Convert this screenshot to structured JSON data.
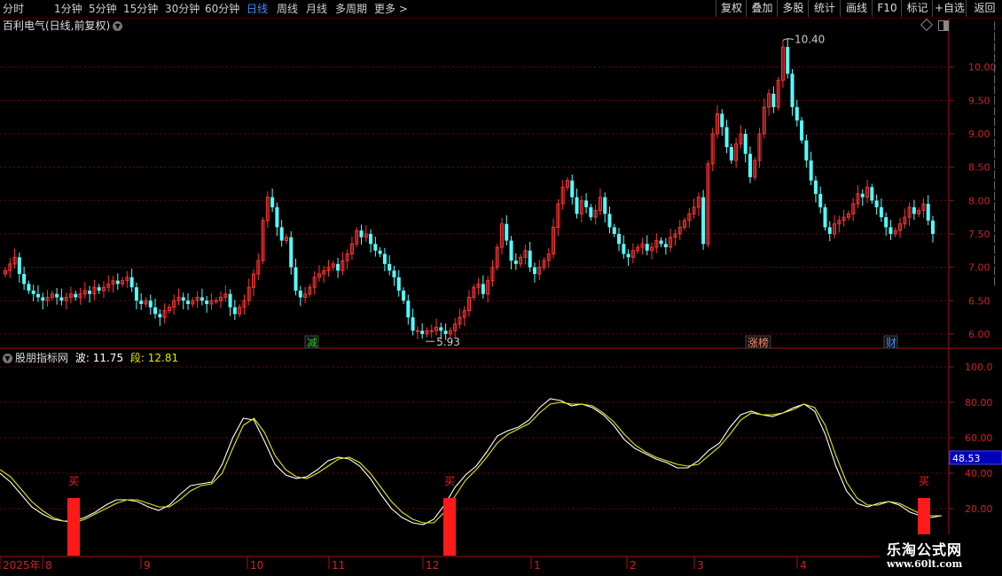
{
  "topbar": {
    "periods": [
      "分时",
      "1分钟",
      "5分钟",
      "15分钟",
      "30分钟",
      "60分钟",
      "日线",
      "周线",
      "月线",
      "多周期",
      "更多 >"
    ],
    "active_period": "日线",
    "right_buttons": [
      "复权",
      "叠加",
      "多股",
      "统计",
      "画线",
      "F10",
      "标记",
      "+自选",
      "返回"
    ]
  },
  "main_chart": {
    "title": "百利电气(日线,前复权)",
    "price_labels": [
      "10.00",
      "9.50",
      "9.00",
      "8.50",
      "8.00",
      "7.50",
      "7.00",
      "6.50",
      "6.00"
    ],
    "high_annotation": "10.40",
    "low_annotation": "5.93",
    "event_tags": [
      {
        "text": "减",
        "color": "#22cc22"
      },
      {
        "text": "涨榜",
        "color": "#ff8866"
      },
      {
        "text": "财",
        "color": "#3f8cff"
      }
    ]
  },
  "indicator": {
    "name": "股朋指标网",
    "wave_label": "波:",
    "wave_value": "11.75",
    "segment_label": "段:",
    "segment_value": "12.81",
    "axis_labels": [
      "100.0",
      "80.00",
      "60.00",
      "40.00",
      "20.00"
    ],
    "current_value": "48.53",
    "buy_label": "买"
  },
  "time_axis": [
    "2025年",
    "8",
    "9",
    "10",
    "11",
    "12",
    "1",
    "2",
    "3",
    "4"
  ],
  "watermark": {
    "line1": "乐淘公式网",
    "line2": "www.60lt.com"
  },
  "colors": {
    "up": "#ff3232",
    "down": "#54ffff",
    "grid": "#7a0000",
    "axis": "#aa1111",
    "wave": "#ffffff",
    "segment": "#e8e800",
    "buy": "#ff1a1a",
    "active": "#3f8cff"
  },
  "chart_data": [
    {
      "type": "candlestick",
      "title": "百利电气(日线,前复权)",
      "ylim": [
        5.8,
        10.5
      ],
      "x_tick_labels": [
        "2025年",
        "8",
        "9",
        "10",
        "11",
        "12",
        "1",
        "2",
        "3",
        "4"
      ],
      "annotations": [
        {
          "text": "10.40",
          "value": 10.4
        },
        {
          "text": "5.93",
          "value": 5.93
        }
      ],
      "close": [
        6.95,
        7.05,
        7.15,
        6.9,
        6.75,
        6.65,
        6.6,
        6.55,
        6.5,
        6.55,
        6.6,
        6.55,
        6.5,
        6.55,
        6.6,
        6.55,
        6.6,
        6.65,
        6.6,
        6.7,
        6.65,
        6.7,
        6.75,
        6.8,
        6.75,
        6.8,
        6.85,
        6.7,
        6.5,
        6.45,
        6.5,
        6.4,
        6.3,
        6.25,
        6.35,
        6.4,
        6.5,
        6.55,
        6.5,
        6.45,
        6.5,
        6.55,
        6.5,
        6.45,
        6.5,
        6.5,
        6.55,
        6.6,
        6.4,
        6.3,
        6.4,
        6.5,
        6.7,
        6.9,
        7.1,
        7.7,
        8.05,
        7.9,
        7.6,
        7.4,
        7.45,
        7.0,
        6.65,
        6.55,
        6.6,
        6.7,
        6.85,
        6.9,
        6.95,
        7.0,
        7.05,
        6.95,
        7.1,
        7.2,
        7.35,
        7.55,
        7.45,
        7.5,
        7.35,
        7.25,
        7.2,
        7.05,
        6.95,
        6.85,
        6.65,
        6.5,
        6.25,
        6.05,
        6.05,
        6.0,
        6.05,
        6.05,
        6.1,
        6.05,
        6.0,
        6.05,
        6.15,
        6.25,
        6.35,
        6.55,
        6.7,
        6.75,
        6.6,
        6.8,
        7.0,
        7.3,
        7.65,
        7.4,
        7.1,
        7.05,
        7.15,
        7.25,
        7.0,
        6.9,
        7.0,
        7.1,
        7.2,
        7.6,
        7.95,
        8.2,
        8.3,
        8.05,
        7.8,
        8.0,
        7.9,
        7.75,
        7.85,
        8.05,
        7.8,
        7.6,
        7.5,
        7.35,
        7.2,
        7.15,
        7.25,
        7.3,
        7.35,
        7.25,
        7.3,
        7.4,
        7.35,
        7.3,
        7.45,
        7.5,
        7.6,
        7.7,
        7.8,
        7.9,
        8.05,
        7.35,
        8.55,
        9.0,
        9.3,
        9.1,
        8.8,
        8.6,
        8.85,
        9.0,
        8.7,
        8.35,
        8.6,
        9.0,
        9.4,
        9.6,
        9.4,
        9.8,
        10.3,
        9.9,
        9.4,
        9.2,
        8.9,
        8.6,
        8.3,
        8.1,
        7.9,
        7.6,
        7.5,
        7.65,
        7.7,
        7.75,
        7.8,
        7.95,
        8.1,
        8.05,
        8.2,
        8.0,
        7.9,
        7.75,
        7.6,
        7.5,
        7.55,
        7.65,
        7.75,
        7.9,
        7.8,
        7.85,
        7.95,
        7.7,
        7.5
      ],
      "series": [
        {
          "name": "波",
          "last": 11.75,
          "values": [
            40,
            35,
            28,
            21,
            17,
            14,
            13,
            13,
            15,
            18,
            22,
            25,
            25,
            24,
            21,
            19,
            22,
            28,
            33,
            34,
            35,
            45,
            60,
            71,
            70,
            58,
            45,
            39,
            37,
            38,
            42,
            47,
            49,
            48,
            44,
            37,
            28,
            20,
            15,
            12,
            11,
            14,
            22,
            32,
            39,
            44,
            52,
            61,
            64,
            66,
            70,
            77,
            82,
            81,
            78,
            79,
            77,
            73,
            67,
            59,
            54,
            51,
            48,
            46,
            43,
            43,
            47,
            53,
            57,
            66,
            73,
            75,
            73,
            72,
            74,
            77,
            79,
            75,
            62,
            44,
            30,
            23,
            21,
            23,
            24,
            22,
            18,
            16,
            15,
            16
          ]
        },
        {
          "name": "段",
          "last": 12.81,
          "values": [
            42,
            38,
            31,
            24,
            19,
            15,
            13,
            12,
            14,
            17,
            20,
            23,
            25,
            25,
            23,
            21,
            21,
            25,
            30,
            33,
            34,
            40,
            54,
            67,
            71,
            63,
            50,
            42,
            38,
            37,
            40,
            44,
            48,
            49,
            46,
            40,
            32,
            24,
            18,
            14,
            12,
            12,
            18,
            27,
            36,
            42,
            49,
            57,
            62,
            65,
            68,
            74,
            79,
            80,
            79,
            79,
            78,
            74,
            69,
            62,
            56,
            52,
            49,
            47,
            45,
            44,
            45,
            50,
            55,
            62,
            70,
            74,
            73,
            73,
            74,
            76,
            79,
            77,
            67,
            50,
            35,
            26,
            22,
            22,
            24,
            23,
            20,
            17,
            16,
            16
          ]
        }
      ]
    }
  ]
}
